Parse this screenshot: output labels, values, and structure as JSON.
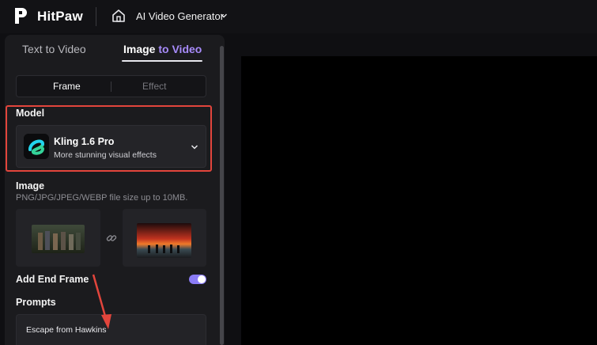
{
  "header": {
    "brand": "HitPaw",
    "nav_title": "AI Video Generator"
  },
  "tabs": [
    {
      "label": "Text to Video",
      "active": false
    },
    {
      "label_prefix": "Image ",
      "label_accent": "to Video",
      "active": true
    }
  ],
  "segment": {
    "frame": "Frame",
    "effect": "Effect",
    "selected": "Frame"
  },
  "model": {
    "label": "Model",
    "name": "Kling 1.6 Pro",
    "description": "More stunning visual effects"
  },
  "image_section": {
    "label": "Image",
    "hint": "PNG/JPG/JPEG/WEBP file size up to 10MB."
  },
  "end_frame": {
    "label": "Add End Frame",
    "enabled": true
  },
  "prompts": {
    "label": "Prompts",
    "value": "Escape from Hawkins"
  },
  "colors": {
    "accent": "#a78bfa",
    "toggle_on": "#8b7cf6",
    "highlight": "#e2453c",
    "panel": "#1b1b1e",
    "background": "#0f0f12"
  },
  "icons": [
    "hitpaw-logo-icon",
    "home-icon",
    "chevron-down-icon",
    "kling-model-icon",
    "link-icon"
  ]
}
